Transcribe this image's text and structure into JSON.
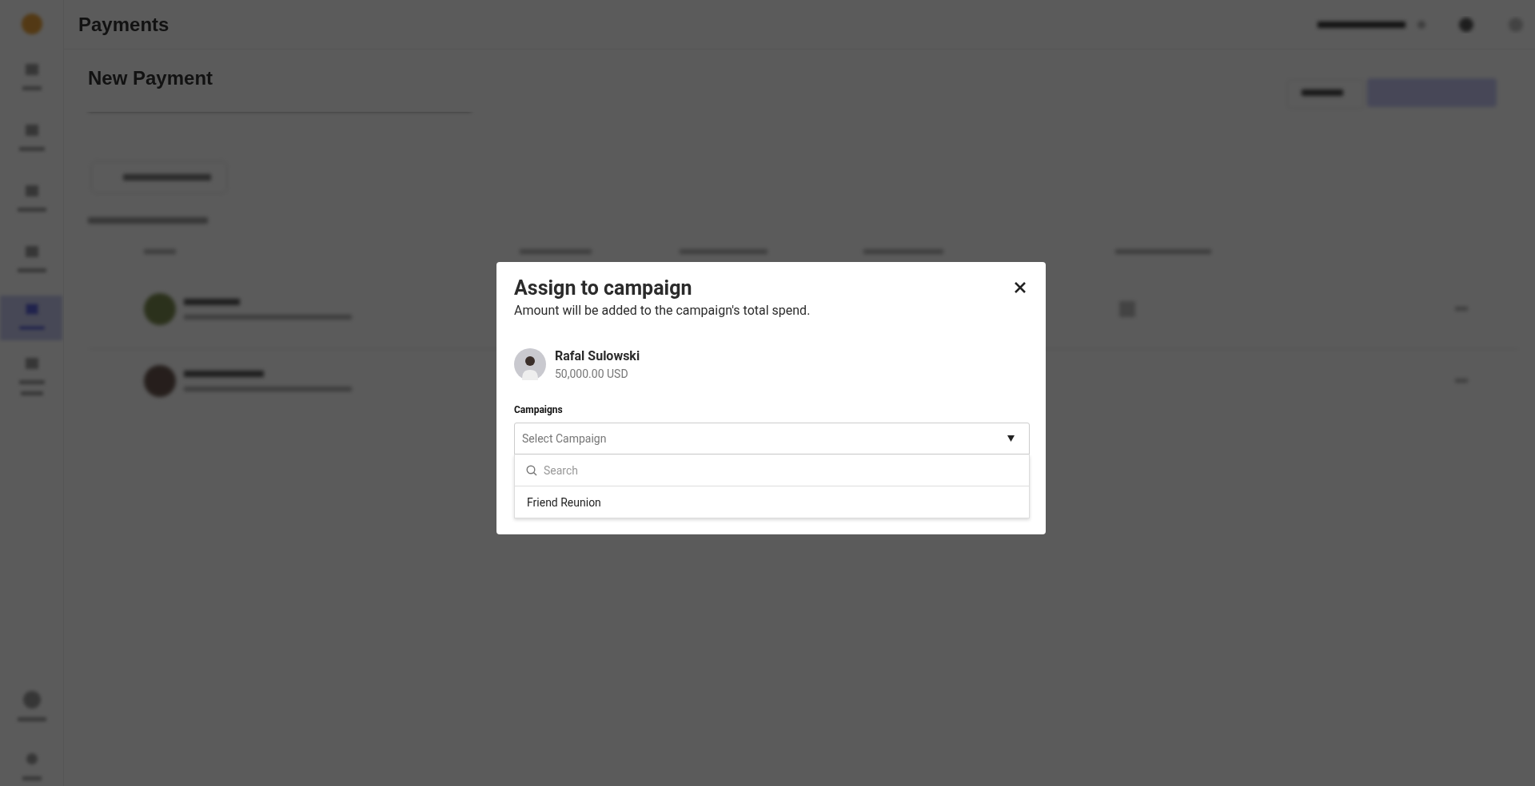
{
  "background": {
    "app_title": "Payments",
    "page_title": "New Payment"
  },
  "dialog": {
    "title": "Assign to campaign",
    "subtitle": "Amount will be added to the campaign's total spend.",
    "payee": {
      "name": "Rafal Sulowski",
      "amount": "50,000.00 USD"
    },
    "field_label": "Campaigns",
    "select": {
      "placeholder": "Select Campaign",
      "expanded": true
    },
    "search": {
      "placeholder": "Search"
    },
    "options": [
      {
        "label": "Friend Reunion",
        "selected": false
      }
    ]
  }
}
